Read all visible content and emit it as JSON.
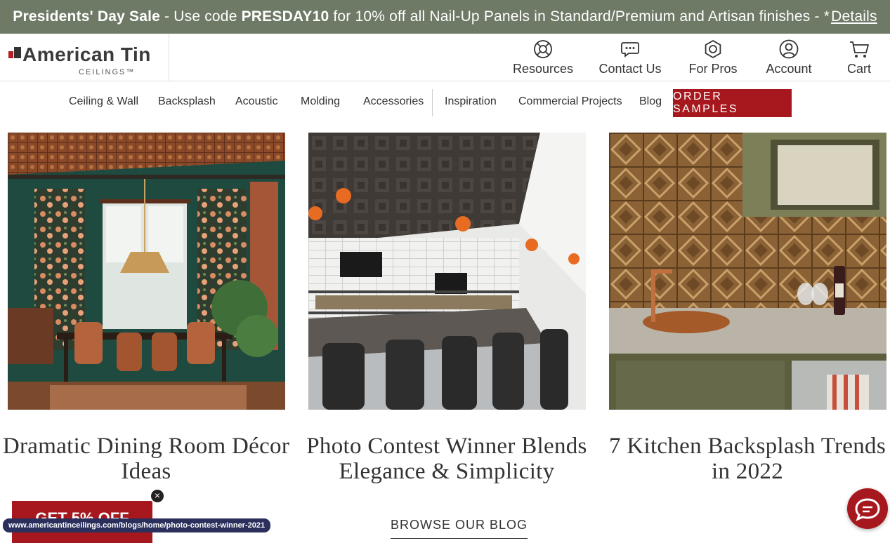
{
  "promo": {
    "sale_name": "Presidents' Day Sale",
    "dash": "-",
    "use_code_text": "Use code",
    "code": "PRESDAY10",
    "offer_text": "for 10% off all Nail-Up Panels in Standard/Premium and Artisan finishes",
    "trail": "- *",
    "details_label": "Details"
  },
  "brand": {
    "name": "American Tin",
    "sub": "CEILINGS",
    "trademark": "™"
  },
  "utility_nav": [
    {
      "label": "Resources",
      "icon": "lifebuoy-icon"
    },
    {
      "label": "Contact Us",
      "icon": "chat-bubble-icon"
    },
    {
      "label": "For Pros",
      "icon": "hex-nut-icon"
    },
    {
      "label": "Account",
      "icon": "user-icon"
    },
    {
      "label": "Cart",
      "icon": "cart-icon"
    }
  ],
  "main_nav": {
    "items": [
      "Ceiling & Wall",
      "Backsplash",
      "Acoustic",
      "Molding",
      "Accessories",
      "Inspiration",
      "Commercial Projects",
      "Blog"
    ],
    "cta": "ORDER SAMPLES"
  },
  "colors": {
    "promo_bg": "#6f7a66",
    "brand_red": "#a6181e"
  },
  "blog_cards": [
    {
      "title": "Dramatic Dining Room Décor Ideas"
    },
    {
      "title": "Photo Contest Winner Blends Elegance & Simplicity"
    },
    {
      "title": "7 Kitchen Backsplash Trends in 2022"
    }
  ],
  "browse_label": "BROWSE OUR BLOG",
  "discount_tab": {
    "label": "GET 5% OFF",
    "close_glyph": "×"
  },
  "status_url": "www.americantinceilings.com/blogs/home/photo-contest-winner-2021"
}
